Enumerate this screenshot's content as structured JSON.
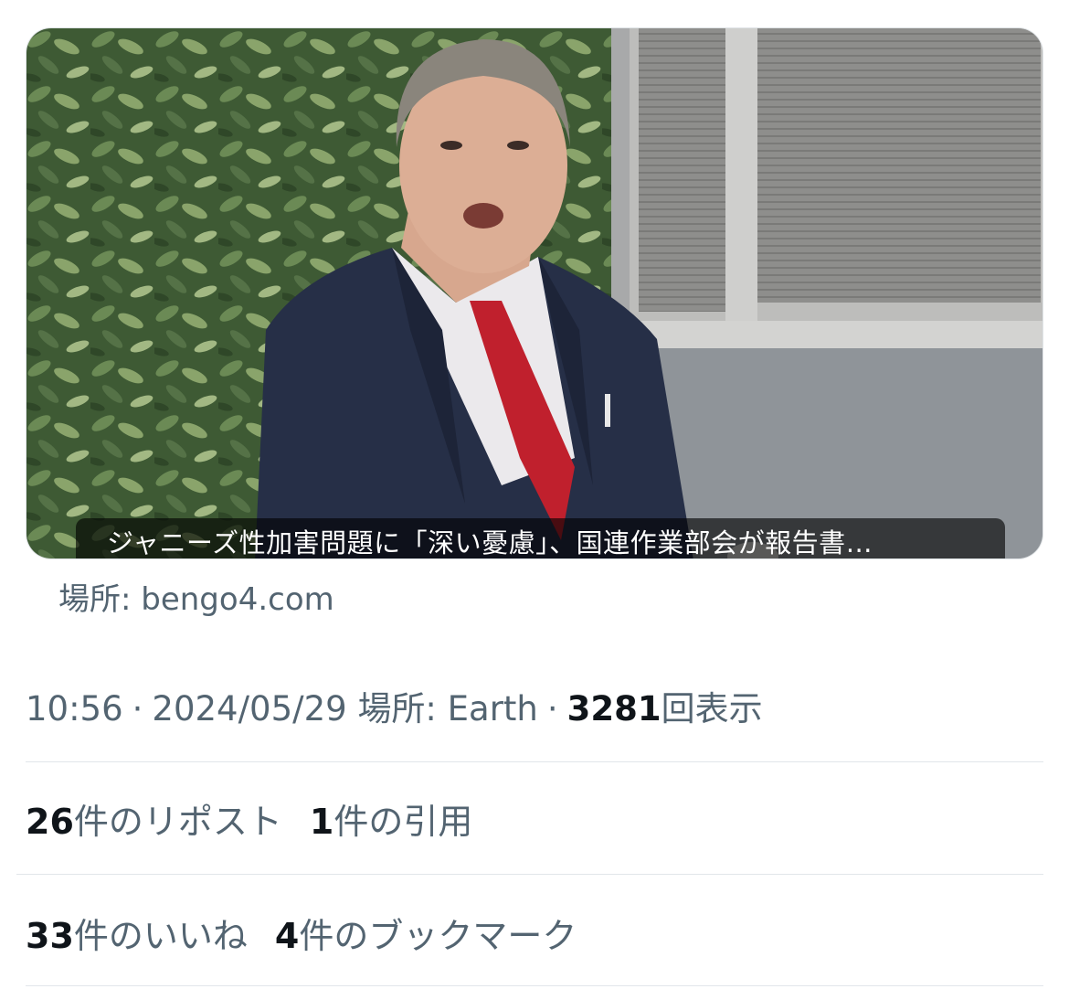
{
  "link_card": {
    "image_alt": "Man in navy suit and red tie speaking in front of a hedge and a building",
    "headline": "ジャニーズ性加害問題に「深い憂慮」、国連作業部会が報告書…",
    "source": "場所: bengo4.com"
  },
  "post_meta": {
    "time": "10:56",
    "separator": "·",
    "date": "2024/05/29",
    "location": "場所: Earth",
    "views_count": "3281",
    "views_label": "回表示"
  },
  "stats": {
    "reposts_count": "26",
    "reposts_label": "件のリポスト",
    "quotes_count": "1",
    "quotes_label": "件の引用",
    "likes_count": "33",
    "likes_label": "件のいいね",
    "bookmarks_count": "4",
    "bookmarks_label": "件のブックマーク"
  },
  "colors": {
    "primary_text": "#0f1419",
    "secondary_text": "#536471",
    "divider": "#e1e6ea"
  }
}
